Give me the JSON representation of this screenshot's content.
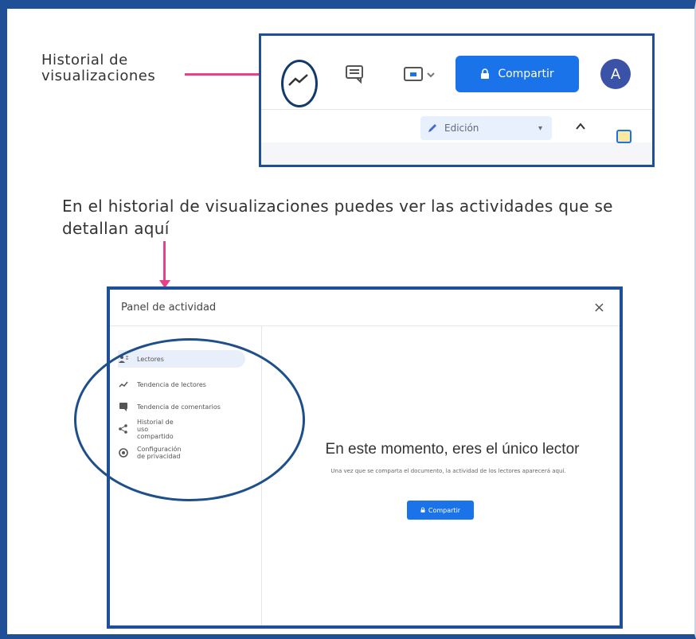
{
  "callout": {
    "title": "Historial de visualizaciones"
  },
  "toolbar": {
    "activity_icon": "trending-up-icon",
    "comments_icon": "comment-icon",
    "present_icon": "present-icon",
    "share_label": "Compartir",
    "avatar_initial": "A",
    "edit_mode_label": "Edición",
    "colors": {
      "share": "#1a73e8",
      "avatar": "#3a53a9",
      "highlight": "#e8418a",
      "frame": "#1f4f96"
    }
  },
  "heading": "En el historial de visualizaciones puedes ver las actividades que se detallan aquí",
  "panel": {
    "title": "Panel de actividad",
    "close": "×",
    "sidebar": [
      {
        "label": "Lectores",
        "icon": "people-icon"
      },
      {
        "label": "Tendencia de lectores",
        "icon": "trend-icon"
      },
      {
        "label": "Tendencia de comentarios",
        "icon": "comment-icon"
      },
      {
        "label": "Historial de uso compartido",
        "icon": "share-icon"
      },
      {
        "label": "Configuración de privacidad",
        "icon": "settings-icon"
      }
    ],
    "empty_title": "En este momento, eres el único lector",
    "empty_desc": "Una vez que se comparta el documento, la actividad de los lectores aparecerá aquí.",
    "share_label": "Compartir"
  }
}
